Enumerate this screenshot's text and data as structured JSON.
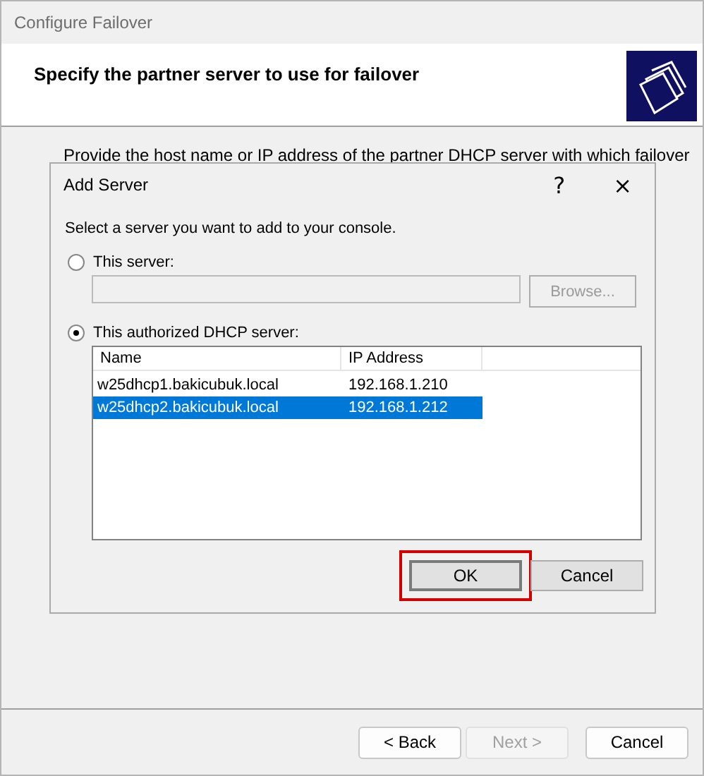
{
  "window": {
    "title": "Configure Failover"
  },
  "header": {
    "title": "Specify the partner server to use for failover"
  },
  "body": {
    "text": "Provide the host name or IP address of the partner DHCP server with which failover"
  },
  "dialog": {
    "title": "Add Server",
    "help": "?",
    "close": "×",
    "prompt": "Select a server you want to add to your console.",
    "options": [
      {
        "label": "This server:",
        "selected": false,
        "kind": "field"
      },
      {
        "label": "This authorized DHCP server:",
        "selected": true,
        "kind": "list"
      }
    ],
    "browse": {
      "label": "Browse...",
      "disabled": true
    },
    "table": {
      "columns": [
        "Name",
        "IP Address"
      ],
      "rows": [
        {
          "name": "w25dhcp1.bakicubuk.local",
          "ip": "192.168.1.210",
          "selected": false
        },
        {
          "name": "w25dhcp2.bakicubuk.local",
          "ip": "192.168.1.212",
          "selected": true
        }
      ]
    },
    "buttons": [
      {
        "label": "OK",
        "highlighted": true
      },
      {
        "label": "Cancel",
        "highlighted": false
      }
    ]
  },
  "footer": {
    "buttons": [
      {
        "label": "< Back",
        "disabled": false
      },
      {
        "label": "Next >",
        "disabled": true
      },
      {
        "label": "Cancel",
        "disabled": false
      }
    ]
  }
}
